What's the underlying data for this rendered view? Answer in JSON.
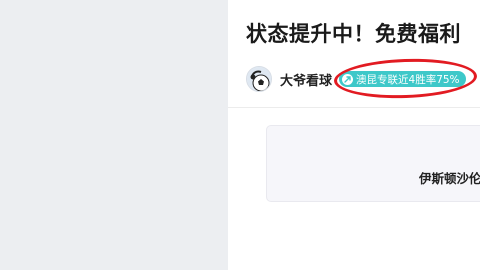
{
  "article": {
    "title": "状态提升中！免费福利",
    "author": {
      "name": "大爷看球",
      "avatar_icon": "soccer-ball-icon"
    },
    "badge": {
      "icon": "trend-up-icon",
      "text": "澳昆专联近4胜率75%",
      "color": "#3ec8c9"
    },
    "annotation_color": "#e21b22"
  },
  "match": {
    "team": "伊斯顿沙伦"
  }
}
